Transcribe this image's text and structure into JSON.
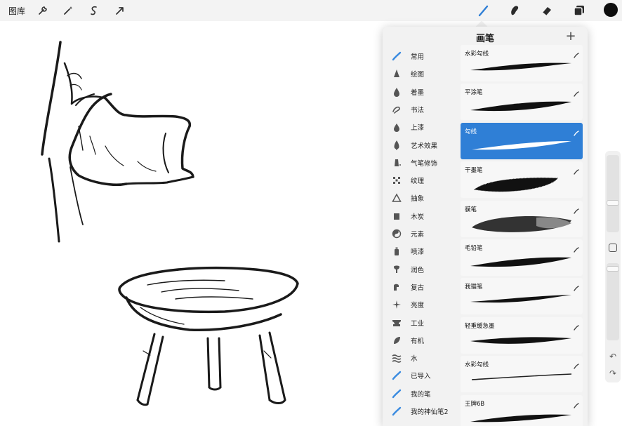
{
  "toolbar": {
    "gallery_label": "图库",
    "left_tools": [
      "wrench-icon",
      "magic-wand-icon",
      "selection-icon",
      "transform-arrow-icon"
    ],
    "right_tools": [
      "brush-icon",
      "smudge-icon",
      "eraser-icon",
      "layers-icon"
    ],
    "current_color": "#0d0d0d"
  },
  "brush_panel": {
    "title": "画笔",
    "add_label": "+",
    "categories": [
      {
        "label": "常用",
        "icon": "brush-stroke-icon",
        "active": true
      },
      {
        "label": "绘图",
        "icon": "pencil-tip-icon"
      },
      {
        "label": "着墨",
        "icon": "ink-drop-icon"
      },
      {
        "label": "书法",
        "icon": "calligraphy-icon"
      },
      {
        "label": "上漆",
        "icon": "paint-drop-icon"
      },
      {
        "label": "艺术效果",
        "icon": "artistic-icon"
      },
      {
        "label": "气笔修饰",
        "icon": "airbrush-icon"
      },
      {
        "label": "纹理",
        "icon": "texture-icon"
      },
      {
        "label": "抽象",
        "icon": "triangle-icon"
      },
      {
        "label": "木炭",
        "icon": "charcoal-icon"
      },
      {
        "label": "元素",
        "icon": "yin-yang-icon"
      },
      {
        "label": "喷漆",
        "icon": "spray-can-icon"
      },
      {
        "label": "润色",
        "icon": "touchup-icon"
      },
      {
        "label": "复古",
        "icon": "retro-icon"
      },
      {
        "label": "亮度",
        "icon": "sparkle-icon"
      },
      {
        "label": "工业",
        "icon": "anvil-icon"
      },
      {
        "label": "有机",
        "icon": "leaf-icon"
      },
      {
        "label": "水",
        "icon": "waves-icon"
      },
      {
        "label": "已导入",
        "icon": "brush-stroke-icon"
      },
      {
        "label": "我的笔",
        "icon": "brush-stroke-icon"
      },
      {
        "label": "我的神仙笔2",
        "icon": "brush-stroke-icon"
      }
    ],
    "brushes": [
      {
        "name": "水彩勾线",
        "selected": false
      },
      {
        "name": "平涂笔",
        "selected": false
      },
      {
        "name": "勾线",
        "selected": true
      },
      {
        "name": "干墨笔",
        "selected": false
      },
      {
        "name": "貘笔",
        "selected": false
      },
      {
        "name": "毛铅笔",
        "selected": false
      },
      {
        "name": "我猫笔",
        "selected": false
      },
      {
        "name": "轻重缓急墨",
        "selected": false
      },
      {
        "name": "水彩勾线",
        "selected": false
      },
      {
        "name": "王牌6B",
        "selected": false
      }
    ],
    "accent_color": "#2f7fd6"
  },
  "sidebar": {
    "undo_label": "↶",
    "redo_label": "↷"
  }
}
